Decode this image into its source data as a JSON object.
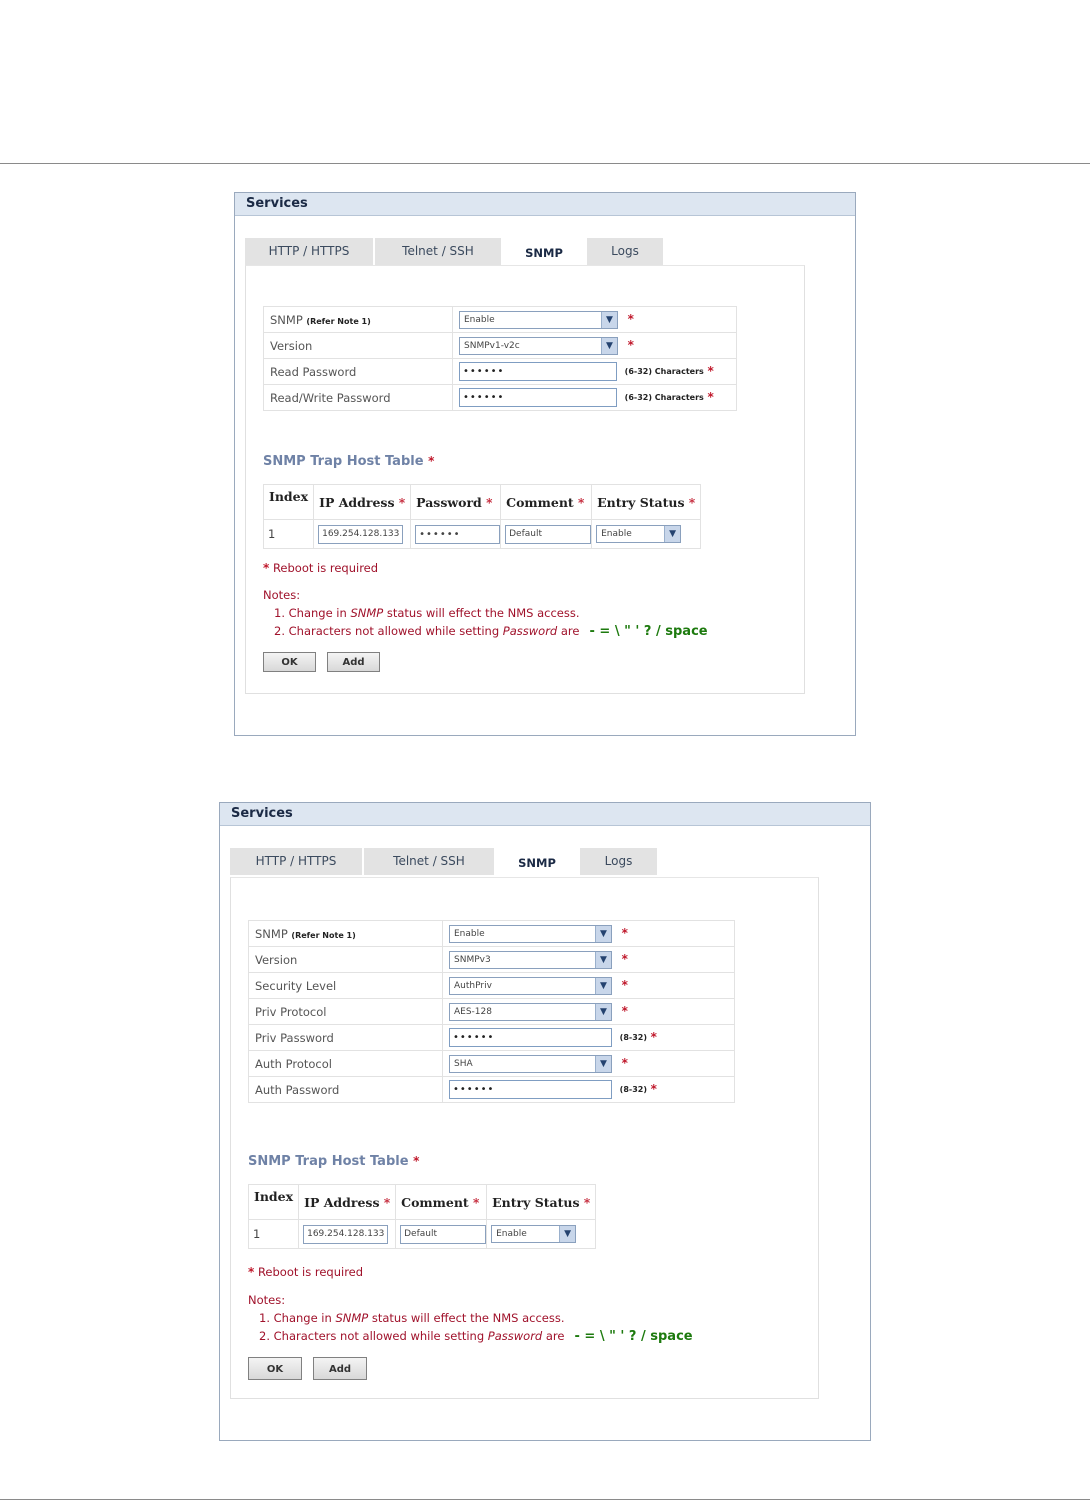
{
  "panels": [
    {
      "title": "Services",
      "tabs": [
        "HTTP / HTTPS",
        "Telnet / SSH",
        "SNMP",
        "Logs"
      ],
      "active_tab": "SNMP",
      "fields": [
        {
          "label": "SNMP",
          "label_note": "(Refer Note 1)",
          "type": "select",
          "value": "Enable"
        },
        {
          "label": "Version",
          "type": "select",
          "value": "SNMPv1-v2c"
        },
        {
          "label": "Read Password",
          "type": "password",
          "value": "••••••",
          "hint": "(6-32) Characters"
        },
        {
          "label": "Read/Write Password",
          "type": "password",
          "value": "••••••",
          "hint": "(6-32) Characters"
        }
      ],
      "trap_title": "SNMP Trap Host Table",
      "trap_headers": [
        "Index",
        "IP Address",
        "Password",
        "Comment",
        "Entry Status"
      ],
      "trap_row": {
        "index": "1",
        "ip": "169.254.128.133",
        "password": "••••••",
        "comment": "Default",
        "status": "Enable"
      },
      "reboot": "Reboot is required",
      "notes_title": "Notes:",
      "note1_pre": "1. Change in ",
      "note1_em": "SNMP",
      "note1_post": " status will effect the NMS access.",
      "note2_pre": "2. Characters not allowed while setting ",
      "note2_em": "Password",
      "note2_post": " are",
      "chars": "- = \\ \" ' ? / space",
      "ok": "OK",
      "add": "Add"
    },
    {
      "title": "Services",
      "tabs": [
        "HTTP / HTTPS",
        "Telnet / SSH",
        "SNMP",
        "Logs"
      ],
      "active_tab": "SNMP",
      "fields": [
        {
          "label": "SNMP",
          "label_note": "(Refer Note 1)",
          "type": "select",
          "value": "Enable"
        },
        {
          "label": "Version",
          "type": "select",
          "value": "SNMPv3"
        },
        {
          "label": "Security Level",
          "type": "select",
          "value": "AuthPriv"
        },
        {
          "label": "Priv Protocol",
          "type": "select",
          "value": "AES-128"
        },
        {
          "label": "Priv Password",
          "type": "password",
          "value": "••••••",
          "hint": "(8-32)"
        },
        {
          "label": "Auth Protocol",
          "type": "select",
          "value": "SHA"
        },
        {
          "label": "Auth Password",
          "type": "password",
          "value": "••••••",
          "hint": "(8-32)"
        }
      ],
      "trap_title": "SNMP Trap Host Table",
      "trap_headers": [
        "Index",
        "IP Address",
        "Comment",
        "Entry Status"
      ],
      "trap_row": {
        "index": "1",
        "ip": "169.254.128.133",
        "comment": "Default",
        "status": "Enable"
      },
      "reboot": "Reboot is required",
      "notes_title": "Notes:",
      "note1_pre": "1. Change in ",
      "note1_em": "SNMP",
      "note1_post": " status will effect the NMS access.",
      "note2_pre": "2. Characters not allowed while setting ",
      "note2_em": "Password",
      "note2_post": " are",
      "chars": "- = \\ \" ' ? / space",
      "ok": "OK",
      "add": "Add"
    }
  ],
  "symbols": {
    "required": "*",
    "dropdown_arrow": "▼"
  }
}
